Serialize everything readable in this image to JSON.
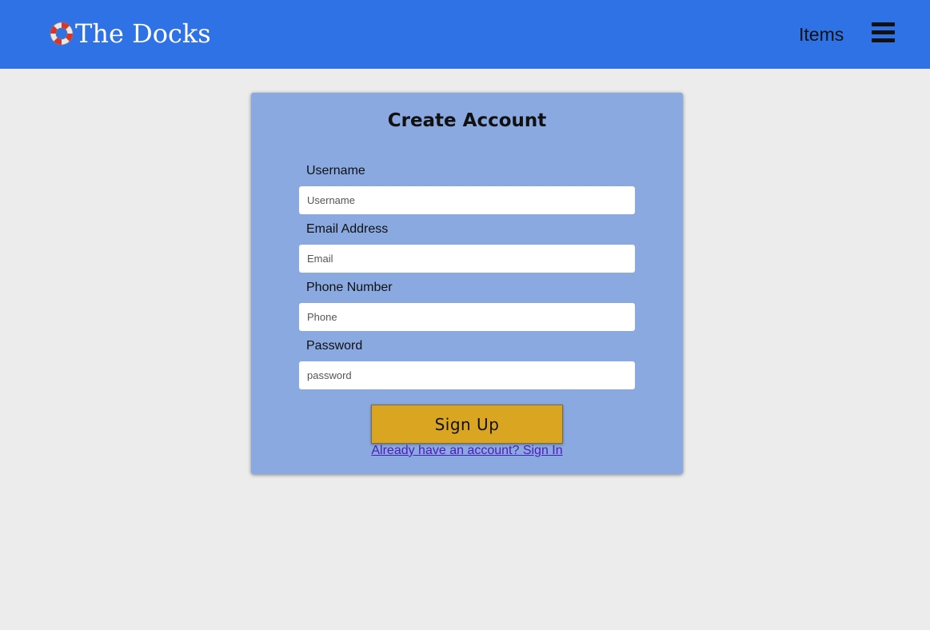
{
  "navbar": {
    "brand_text": "The Docks",
    "brand_icon": "lifebuoy-icon",
    "nav_items_label": "Items",
    "menu_icon": "hamburger-menu-icon",
    "background_color": "#2f72e6"
  },
  "form": {
    "title": "Create Account",
    "fields": [
      {
        "label": "Username",
        "placeholder": "Username",
        "value": ""
      },
      {
        "label": "Email Address",
        "placeholder": "Email",
        "value": ""
      },
      {
        "label": "Phone Number",
        "placeholder": "Phone",
        "value": ""
      },
      {
        "label": "Password",
        "placeholder": "password",
        "value": ""
      }
    ],
    "submit_label": "Sign Up",
    "signin_link_text": "Already have an account? Sign In",
    "card_color": "#89a9e0",
    "button_color": "#daa520"
  }
}
